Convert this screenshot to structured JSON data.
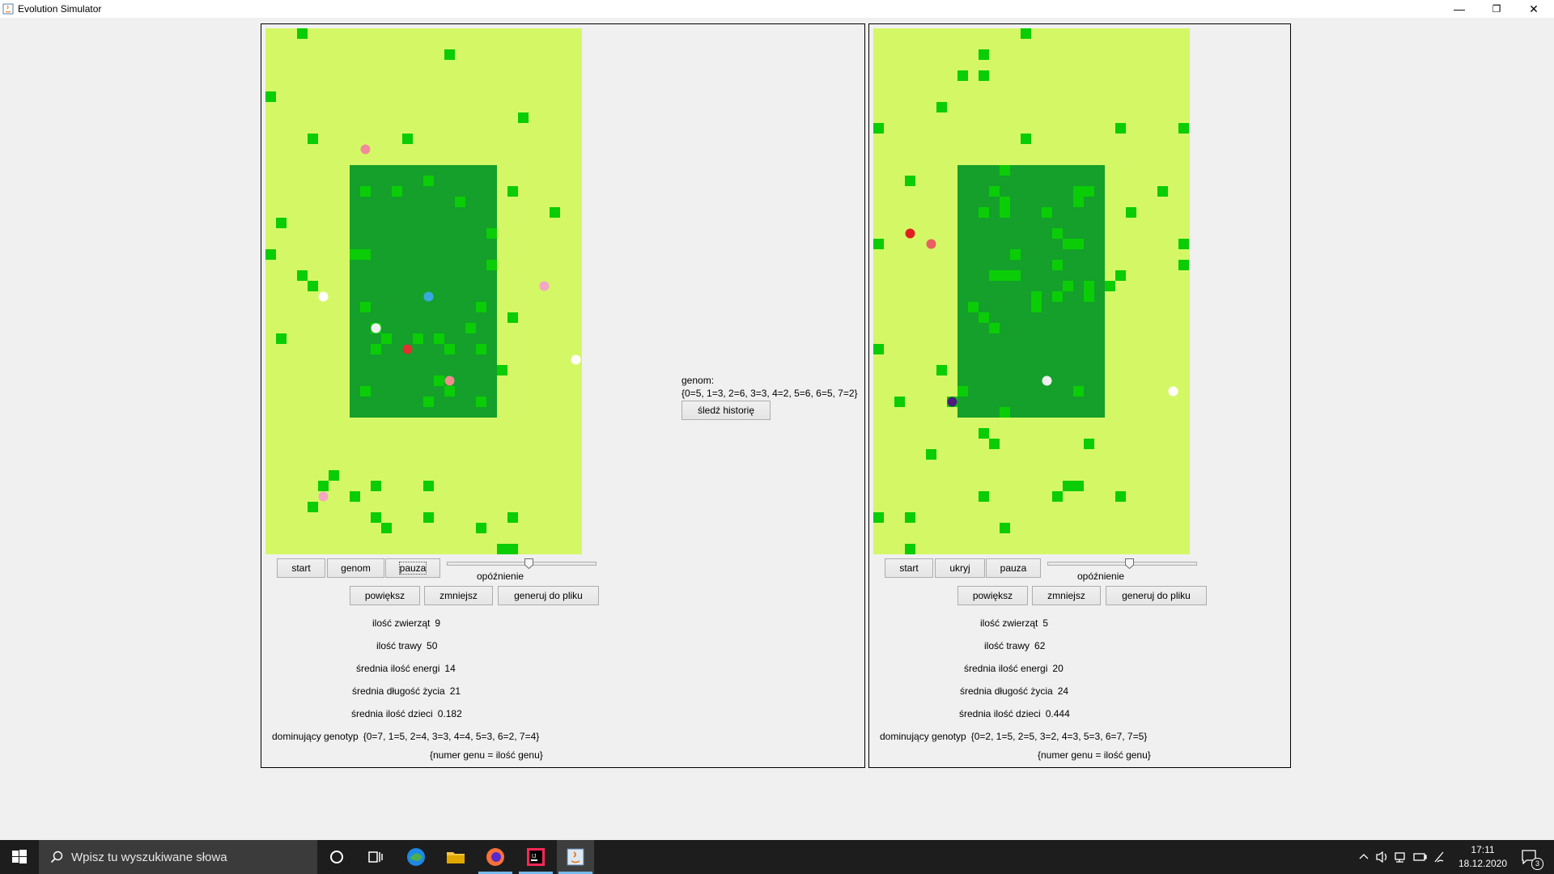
{
  "window": {
    "title": "Evolution Simulator"
  },
  "colors": {
    "steppe": "#d4f865",
    "jungle": "#14a02a",
    "grass": "#0acd07",
    "border": "#000000"
  },
  "left": {
    "buttons": {
      "start": "start",
      "genome": "genom",
      "pause": "pauza",
      "zoom_in": "powiększ",
      "zoom_out": "zmniejsz",
      "export": "generuj do pliku"
    },
    "slider_label": "opóźnienie",
    "slider_value": 0.55,
    "stats": {
      "animals_label": "ilość zwierząt",
      "animals": "9",
      "grass_label": "ilość trawy",
      "grass": "50",
      "energy_label": "średnia ilość energi",
      "energy": "14",
      "lifespan_label": "średnia długość życia",
      "lifespan": "21",
      "children_label": "średnia ilość dzieci",
      "children": "0.182",
      "dominant_label": "dominujący genotyp",
      "dominant": "{0=7, 1=5, 2=4, 3=3, 4=4, 5=3, 6=2, 7=4}"
    },
    "legend": "{numer genu = ilość genu}",
    "selected_genome_label": "genom:",
    "selected_genome": "{0=5, 1=3, 2=6, 3=3, 4=2, 5=6, 6=5, 7=2}",
    "trace_button": "śledź historię"
  },
  "right": {
    "buttons": {
      "start": "start",
      "hide": "ukryj",
      "pause": "pauza",
      "zoom_in": "powiększ",
      "zoom_out": "zmniejsz",
      "export": "generuj do pliku"
    },
    "slider_label": "opóźnienie",
    "slider_value": 0.55,
    "stats": {
      "animals_label": "ilość zwierząt",
      "animals": "5",
      "grass_label": "ilość trawy",
      "grass": "62",
      "energy_label": "średnia ilość energi",
      "energy": "20",
      "lifespan_label": "średnia długość życia",
      "lifespan": "24",
      "children_label": "średnia ilość dzieci",
      "children": "0.444",
      "dominant_label": "dominujący genotyp",
      "dominant": "{0=2, 1=5, 2=5, 3=2, 4=3, 5=3, 6=7, 7=5}"
    },
    "legend": "{numer genu = ilość genu}"
  },
  "taskbar": {
    "search_placeholder": "Wpisz tu wyszukiwane słowa",
    "time": "17:11",
    "date": "18.12.2020",
    "notification_count": "3"
  }
}
